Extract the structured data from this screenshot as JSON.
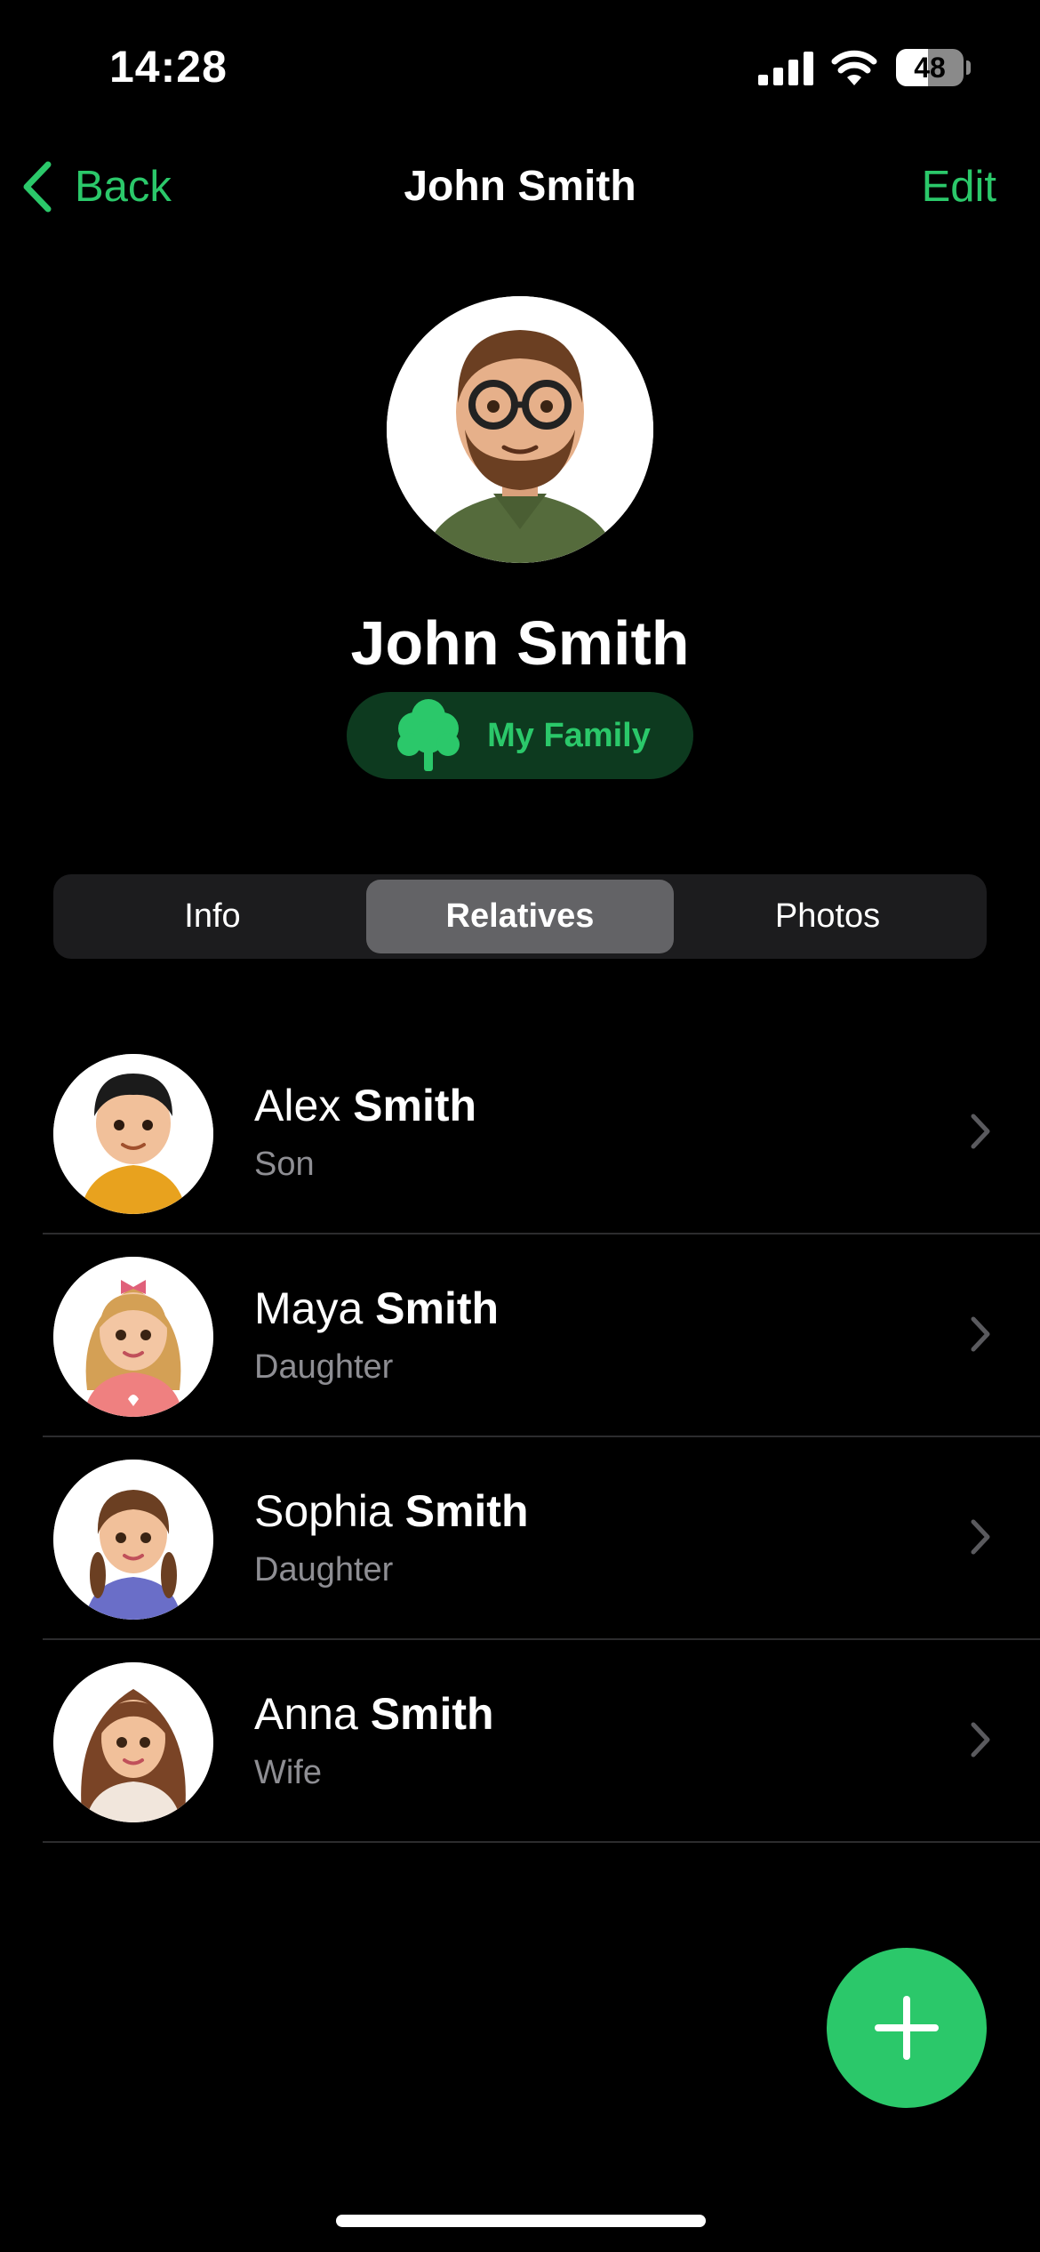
{
  "status_bar": {
    "time": "14:28",
    "battery_level": "48",
    "battery_fraction": 0.48
  },
  "nav": {
    "back_label": "Back",
    "title": "John Smith",
    "edit_label": "Edit"
  },
  "profile": {
    "name": "John Smith",
    "family_label": "My Family"
  },
  "tabs": [
    {
      "label": "Info",
      "active": false
    },
    {
      "label": "Relatives",
      "active": true
    },
    {
      "label": "Photos",
      "active": false
    }
  ],
  "relatives": [
    {
      "first": "Alex",
      "last": "Smith",
      "relation": "Son"
    },
    {
      "first": "Maya",
      "last": "Smith",
      "relation": "Daughter"
    },
    {
      "first": "Sophia",
      "last": "Smith",
      "relation": "Daughter"
    },
    {
      "first": "Anna",
      "last": "Smith",
      "relation": "Wife"
    }
  ],
  "colors": {
    "accent": "#2bc86a",
    "badge_bg": "#0d3a1f",
    "secondary_text": "#8e8e93"
  },
  "icons": {
    "back": "chevron-left-icon",
    "family": "tree-icon",
    "row": "chevron-right-icon",
    "fab": "plus-icon"
  }
}
